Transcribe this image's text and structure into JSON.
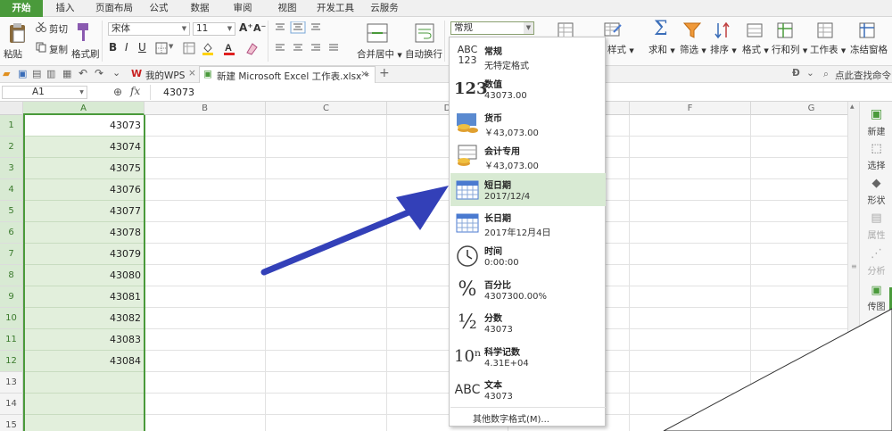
{
  "tabs": [
    "开始",
    "插入",
    "页面布局",
    "公式",
    "数据",
    "审阅",
    "视图",
    "开发工具",
    "云服务"
  ],
  "ribbon": {
    "paste": "粘贴",
    "cut": "剪切",
    "copy": "复制",
    "format_painter": "格式刷",
    "font_name": "宋体",
    "font_size": "11",
    "merge_center": "合并居中",
    "wrap_text": "自动换行",
    "number_format": "常规",
    "sum": "求和",
    "filter": "筛选",
    "sort": "排序",
    "format": "格式",
    "rows_cols": "行和列",
    "worksheet": "工作表",
    "freeze": "冻结窗格",
    "styles_suffix": "样式"
  },
  "doc_tabs": {
    "wps": "我的WPS",
    "file": "新建 Microsoft Excel 工作表.xlsx *"
  },
  "search": {
    "placeholder": "点此查找命令"
  },
  "formula_bar": {
    "name_box": "A1",
    "fx": "fx",
    "value": "43073"
  },
  "columns": [
    "A",
    "B",
    "C",
    "D",
    "E",
    "F",
    "G"
  ],
  "rows": [
    "1",
    "2",
    "3",
    "4",
    "5",
    "6",
    "7",
    "8",
    "9",
    "10",
    "11",
    "12",
    "13",
    "14",
    "15"
  ],
  "cells_a": [
    "43073",
    "43074",
    "43075",
    "43076",
    "43077",
    "43078",
    "43079",
    "43080",
    "43081",
    "43082",
    "43083",
    "43084",
    "",
    "",
    ""
  ],
  "format_menu": {
    "items": [
      {
        "icon": "ABC\n123",
        "label": "常规",
        "sample": "无特定格式"
      },
      {
        "icon": "123",
        "label": "数值",
        "sample": "43073.00"
      },
      {
        "icon": "coins",
        "label": "货币",
        "sample": "￥43,073.00"
      },
      {
        "icon": "ledger",
        "label": "会计专用",
        "sample": "￥43,073.00"
      },
      {
        "icon": "cal",
        "label": "短日期",
        "sample": "2017/12/4"
      },
      {
        "icon": "cal",
        "label": "长日期",
        "sample": "2017年12月4日"
      },
      {
        "icon": "clock",
        "label": "时间",
        "sample": "0:00:00"
      },
      {
        "icon": "%",
        "label": "百分比",
        "sample": "4307300.00%"
      },
      {
        "icon": "½",
        "label": "分数",
        "sample": "43073"
      },
      {
        "icon": "10ⁿ",
        "label": "科学记数",
        "sample": "4.31E+04"
      },
      {
        "icon": "ABC",
        "label": "文本",
        "sample": "43073"
      }
    ],
    "more": "其他数字格式(M)...",
    "highlighted": "短日期"
  },
  "sidebar": {
    "new": "新建",
    "select": "选择",
    "shape": "形状",
    "props": "属性",
    "analysis": "分析",
    "transfer": "传图"
  },
  "colors": {
    "accent": "#4a9a3b",
    "arrow": "#3340b8",
    "highlight": "#d8ead3"
  }
}
